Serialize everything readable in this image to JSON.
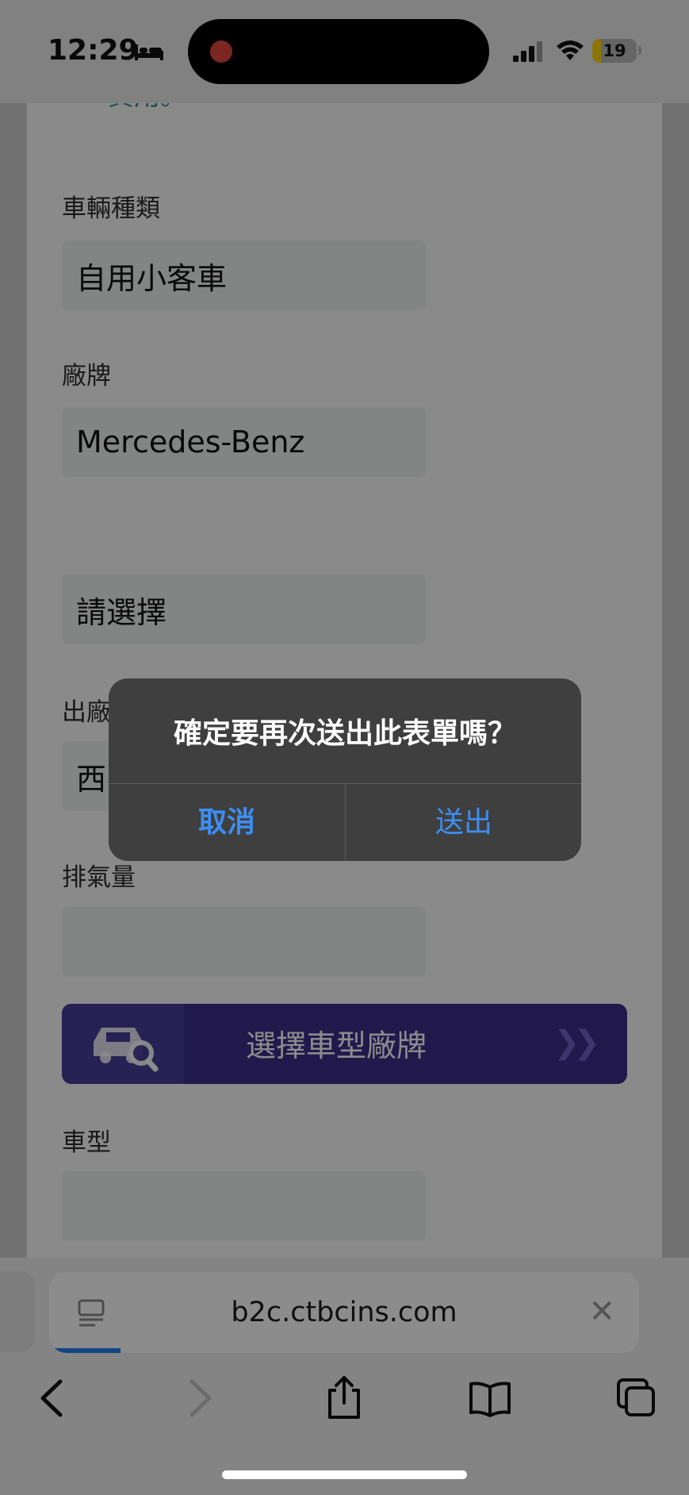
{
  "status_bar": {
    "time": "12:29",
    "battery_level": "19",
    "battery_fraction": 0.19,
    "icons": [
      "bed-icon",
      "recording-dot",
      "cellular-signal-icon",
      "wifi-icon",
      "battery-icon"
    ]
  },
  "form": {
    "notice_line2": "費用。",
    "vehicle_type_label": "車輛種類",
    "vehicle_type_value": "自用小客車",
    "brand_label": "廠牌",
    "brand_value": "Mercedes-Benz",
    "select_placeholder": "請選擇",
    "factory_label_partial": "出廠",
    "factory_value_partial": "西",
    "displacement_label": "排氣量",
    "displacement_value": "",
    "select_model_banner": "選擇車型廠牌",
    "model_label": "車型",
    "model_value": ""
  },
  "alert": {
    "title": "確定要再次送出此表單嗎？",
    "cancel_label": "取消",
    "submit_label": "送出",
    "accent_color": "#3e8ef2"
  },
  "browser": {
    "url": "b2c.ctbcins.com",
    "toolbar_icons": [
      "back-icon",
      "forward-icon",
      "share-icon",
      "bookmarks-icon",
      "tabs-icon"
    ]
  }
}
